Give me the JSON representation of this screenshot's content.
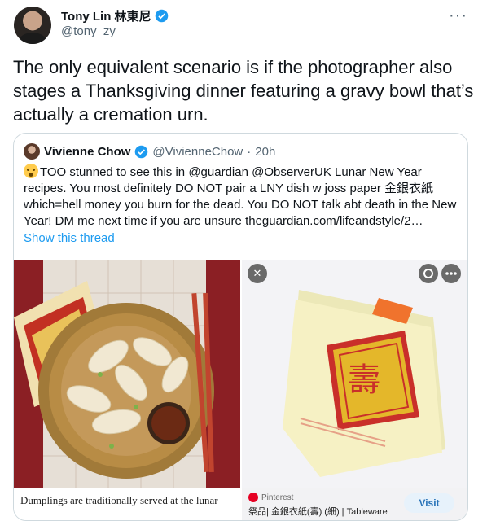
{
  "tweet": {
    "display_name": "Tony Lin 林東尼",
    "handle": "@tony_zy",
    "more_label": "···",
    "text": "The only equivalent scenario is if the photographer also stages a Thanksgiving dinner featuring a gravy bowl that’s actually a cremation urn."
  },
  "quoted": {
    "display_name": "Vivienne Chow",
    "handle": "@VivienneChow",
    "dot": "·",
    "time": "20h",
    "text": "TOO stunned to see this in @guardian @ObserverUK Lunar New Year recipes. You most definitely DO NOT pair a LNY dish w joss paper 金銀衣紙 which=hell money you burn for the dead. You DO NOT talk abt death in the New Year! DM me next time if you are unsure theguardian.com/lifeandstyle/2…",
    "show_thread": "Show this thread"
  },
  "media_left": {
    "caption": "Dumplings are traditionally served at the lunar"
  },
  "media_right": {
    "pinterest_label": "Pinterest",
    "title": "祭品| 金銀衣紙(壽) (細) | Tableware",
    "visit_label": "Visit",
    "close_icon_glyph": "✕",
    "seal_text": "壽"
  },
  "colors": {
    "link": "#1d9bf0",
    "verified": "#1d9bf0",
    "secondary": "#536471"
  },
  "icons": [
    "verified-badge-icon",
    "more-icon",
    "close-icon",
    "lens-icon",
    "pinterest-icon"
  ]
}
